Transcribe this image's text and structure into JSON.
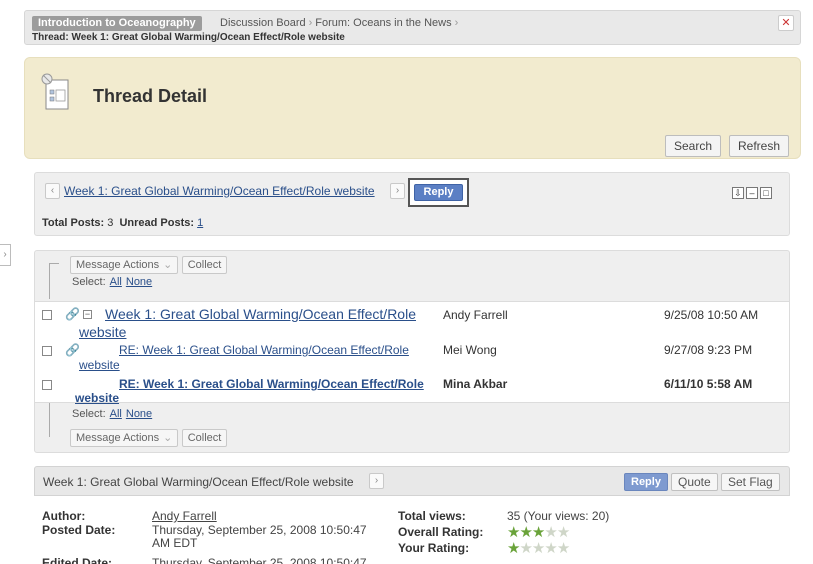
{
  "breadcrumb": {
    "course": "Introduction to Oceanography",
    "items": [
      "Discussion Board",
      "Forum: Oceans in the News"
    ],
    "thread": "Thread: Week 1: Great Global Warming/Ocean Effect/Role website"
  },
  "header": {
    "title": "Thread Detail",
    "search_label": "Search",
    "refresh_label": "Refresh"
  },
  "nav": {
    "thread_title": "Week 1: Great Global Warming/Ocean Effect/Role website",
    "reply_label": "Reply",
    "total_posts_label": "Total Posts:",
    "total_posts": "3",
    "unread_posts_label": "Unread Posts:",
    "unread_posts": "1"
  },
  "list": {
    "message_actions_label": "Message Actions",
    "collect_label": "Collect",
    "select_label": "Select:",
    "select_all": "All",
    "select_none": "None",
    "rows": [
      {
        "subject_line1": "Week 1: Great Global Warming/Ocean Effect/Role",
        "subject_line2": "website",
        "author": "Andy Farrell",
        "date": "9/25/08 10:50 AM"
      },
      {
        "subject_line1": "RE: Week 1: Great Global Warming/Ocean Effect/Role",
        "subject_line2": "website",
        "author": "Mei Wong",
        "date": "9/27/08 9:23 PM"
      },
      {
        "subject_line1": "RE: Week 1: Great Global Warming/Ocean Effect/Role",
        "subject_line2": "website",
        "author": "Mina Akbar",
        "date": "6/11/10 5:58 AM"
      }
    ]
  },
  "detail": {
    "title": "Week 1: Great Global Warming/Ocean Effect/Role website",
    "reply_label": "Reply",
    "quote_label": "Quote",
    "set_flag_label": "Set Flag",
    "author_label": "Author:",
    "author": "Andy Farrell",
    "posted_date_label": "Posted Date:",
    "posted_date_line1": "Thursday, September 25, 2008 10:50:47",
    "posted_date_line2": "AM EDT",
    "edited_date_label": "Edited Date:",
    "edited_date": "Thursday, September 25, 2008 10:50:47",
    "total_views_label": "Total views:",
    "total_views": "35 (Your views: 20)",
    "overall_rating_label": "Overall Rating:",
    "overall_rating": 3,
    "your_rating_label": "Your Rating:",
    "your_rating": 1,
    "rating_max": 5
  },
  "colors": {
    "header_bg": "#f2ebcf",
    "link": "#2a4f8a",
    "reply_button": "#5b7fc4",
    "star_on": "#6aa33a"
  }
}
